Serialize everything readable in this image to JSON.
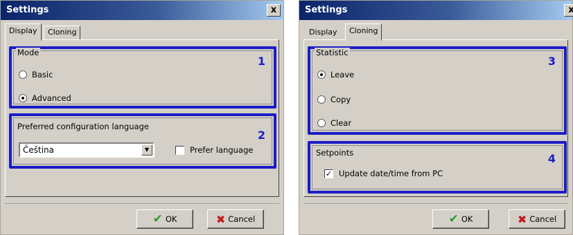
{
  "left_dialog": {
    "title": "Settings",
    "close_glyph": "x",
    "tabs": [
      {
        "label": "Display",
        "active": true
      },
      {
        "label": "Cloning",
        "active": false
      }
    ],
    "mode_group": {
      "title": "Mode",
      "number": "1",
      "options": [
        {
          "label": "Basic",
          "checked": false
        },
        {
          "label": "Advanced",
          "checked": true
        }
      ]
    },
    "language_group": {
      "title": "Preferred configuration language",
      "number": "2",
      "selected_language": "Čeština",
      "prefer_language_label": "Prefer language",
      "prefer_language_checked": false
    },
    "ok_label": "OK",
    "cancel_label": "Cancel"
  },
  "right_dialog": {
    "title": "Settings",
    "close_glyph": "x",
    "tabs": [
      {
        "label": "Display",
        "active": false
      },
      {
        "label": "Cloning",
        "active": true
      }
    ],
    "statistic_group": {
      "title": "Statistic",
      "number": "3",
      "options": [
        {
          "label": "Leave",
          "checked": true
        },
        {
          "label": "Copy",
          "checked": false
        },
        {
          "label": "Clear",
          "checked": false
        }
      ]
    },
    "setpoints_group": {
      "title": "Setpoints",
      "number": "4",
      "update_label": "Update date/time from PC",
      "update_checked": true
    },
    "ok_label": "OK",
    "cancel_label": "Cancel"
  },
  "icons": {
    "ok": "checkmark-icon",
    "cancel": "x-mark-icon",
    "dropdown": "chevron-down-icon"
  },
  "colors": {
    "annotation_blue": "#1c1cc6",
    "ok_green": "#2a9a2a",
    "cancel_red": "#c41a1a"
  }
}
